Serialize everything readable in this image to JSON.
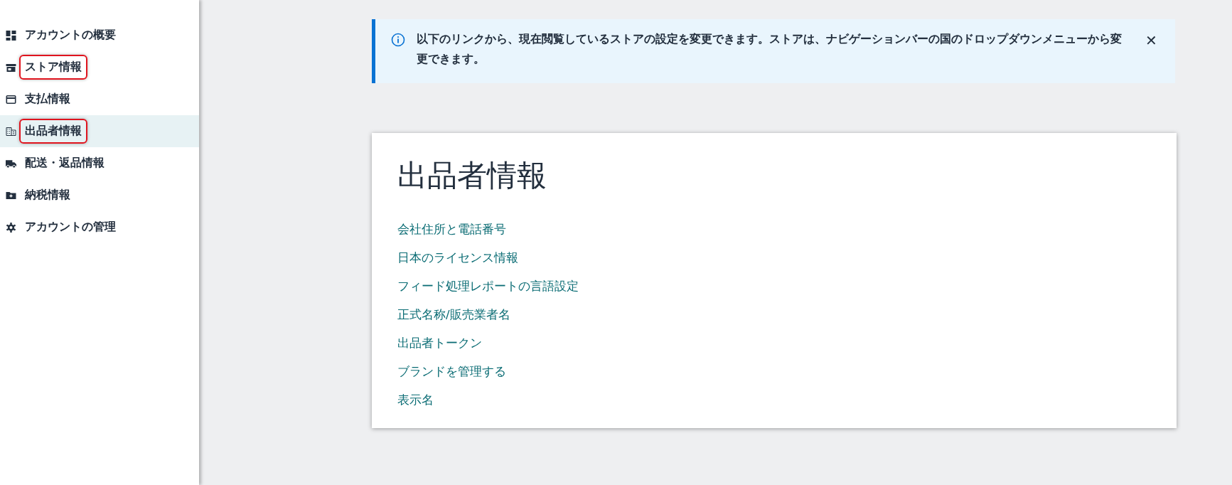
{
  "sidebar": {
    "items": [
      {
        "label": "アカウントの概要",
        "selected": false,
        "highlighted": false
      },
      {
        "label": "ストア情報",
        "selected": false,
        "highlighted": true
      },
      {
        "label": "支払情報",
        "selected": false,
        "highlighted": false
      },
      {
        "label": "出品者情報",
        "selected": true,
        "highlighted": true
      },
      {
        "label": "配送・返品情報",
        "selected": false,
        "highlighted": false
      },
      {
        "label": "納税情報",
        "selected": false,
        "highlighted": false
      },
      {
        "label": "アカウントの管理",
        "selected": false,
        "highlighted": false
      }
    ]
  },
  "banner": {
    "message": "以下のリンクから、現在閲覧しているストアの設定を変更できます。ストアは、ナビゲーションバーの国のドロップダウンメニューから変更できます。",
    "close": "✕"
  },
  "card": {
    "title": "出品者情報",
    "links": [
      "会社住所と電話番号",
      "日本のライセンス情報",
      "フィード処理レポートの言語設定",
      "正式名称/販売業者名",
      "出品者トークン",
      "ブランドを管理する",
      "表示名"
    ]
  }
}
